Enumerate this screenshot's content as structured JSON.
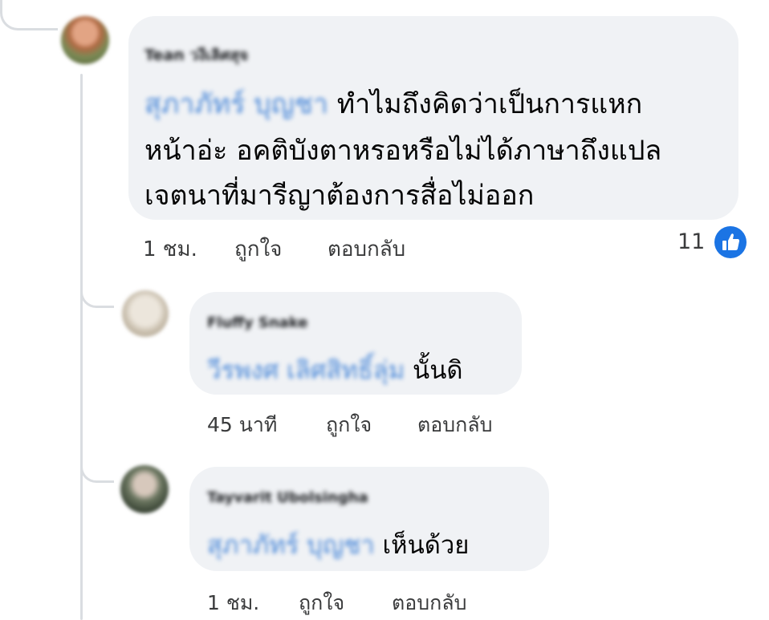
{
  "colors": {
    "bubble": "#f0f2f5",
    "mention": "#4a88d8",
    "like": "#1b74e4",
    "thread_line": "#dadde1"
  },
  "comments": [
    {
      "author": "Tean วงีเลิศสุจ",
      "mention": "สุภาภัทร์ บุญชา",
      "text_lines": [
        "ทำไมถึงคิดว่าเป็นการแหก",
        "หน้าอ่ะ อคติบังตาหรอหรือไม่ได้ภาษาถึงแปล",
        "เจตนาที่มารีญาต้องการสื่อไม่ออก"
      ],
      "time": "1 ชม.",
      "like_label": "ถูกใจ",
      "reply_label": "ตอบกลับ",
      "reactions": {
        "count": "11",
        "icon": "thumbs-up-icon"
      }
    },
    {
      "author": "Fluffy Snake",
      "mention": "วีรพงศ เลิศสิทธิ์ลุ่ม",
      "text": "นั้นดิ",
      "time": "45 นาที",
      "like_label": "ถูกใจ",
      "reply_label": "ตอบกลับ"
    },
    {
      "author": "Tayvarit Ubolsingha",
      "mention": "สุภาภัทร์ บุญชา",
      "text": "เห็นด้วย",
      "time": "1 ชม.",
      "like_label": "ถูกใจ",
      "reply_label": "ตอบกลับ"
    }
  ]
}
